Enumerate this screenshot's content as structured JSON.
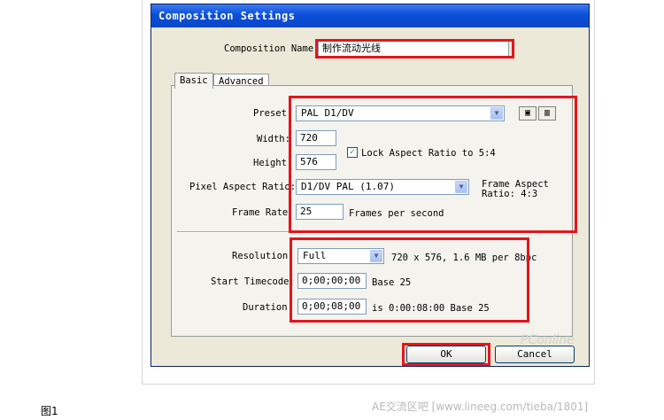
{
  "dialog": {
    "title": "Composition Settings",
    "comp_name_label": "Composition Name:",
    "comp_name_value": "制作流动光线",
    "tabs": [
      "Basic",
      "Advanced"
    ],
    "preset_label": "Preset:",
    "preset_value": "PAL D1/DV",
    "width_label": "Width:",
    "width_value": "720",
    "height_label": "Height:",
    "height_value": "576",
    "lock_label": "Lock Aspect Ratio to 5:4",
    "lock_checked": true,
    "par_label": "Pixel Aspect Ratio:",
    "par_value": "D1/DV PAL (1.07)",
    "frame_aspect_line1": "Frame Aspect",
    "frame_aspect_line2": "Ratio: 4:3",
    "frame_rate_label": "Frame Rate:",
    "frame_rate_value": "25",
    "frame_rate_unit": "Frames per second",
    "resolution_label": "Resolution:",
    "resolution_value": "Full",
    "resolution_info": "720 x 576, 1.6 MB per 8bpc",
    "start_tc_label": "Start Timecode:",
    "start_tc_value": "0;00;00;00",
    "start_tc_base": "Base 25",
    "duration_label": "Duration:",
    "duration_value": "0;00;08;00",
    "duration_info": "is 0:00:08:00  Base 25",
    "ok_label": "OK",
    "cancel_label": "Cancel"
  },
  "caption": "图1",
  "watermark": "AE交流区吧 [www.lineeg.com/tieba/1801]",
  "watermark_logo": "PConline",
  "colors": {
    "highlight": "#e5141c",
    "title_bar": "#0b4fd8",
    "dialog_bg": "#ece9d8"
  }
}
